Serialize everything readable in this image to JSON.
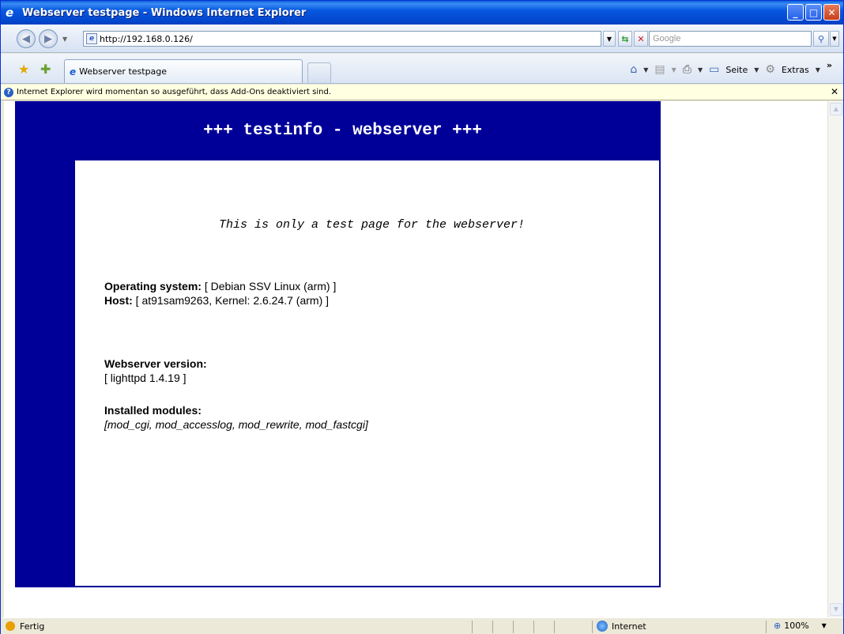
{
  "window": {
    "title": "Webserver testpage - Windows Internet Explorer",
    "min_glyph": "_",
    "max_glyph": "□",
    "close_glyph": "✕"
  },
  "addressbar": {
    "url": "http://192.168.0.126/",
    "search_placeholder": "Google"
  },
  "tabs": [
    {
      "label": "Webserver testpage"
    }
  ],
  "toolbar": {
    "page_label": "Seite",
    "extras_label": "Extras"
  },
  "infobar": {
    "message": "Internet Explorer wird momentan so ausgeführt, dass Add-Ons deaktiviert sind."
  },
  "page": {
    "header": "+++ testinfo - webserver +++",
    "tagline": "This is only a test page for the webserver!",
    "os_label": "Operating system:",
    "os_value": "[ Debian SSV Linux (arm) ]",
    "host_label": "Host:",
    "host_value": "[ at91sam9263, Kernel: 2.6.24.7 (arm) ]",
    "webserver_label": "Webserver version:",
    "webserver_value": "[ lighttpd 1.4.19 ]",
    "modules_label": "Installed modules:",
    "modules_value": "[mod_cgi, mod_accesslog, mod_rewrite, mod_fastcgi]"
  },
  "statusbar": {
    "status": "Fertig",
    "zone": "Internet",
    "zoom": "100%"
  },
  "colors": {
    "page_blue": "#000099"
  }
}
